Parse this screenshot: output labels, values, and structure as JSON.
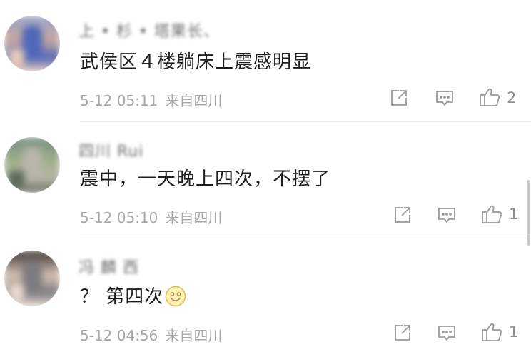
{
  "comments": [
    {
      "username": "上 • 杉 • 塔果长、",
      "text": "武侯区４楼躺床上震感明显",
      "date": "5-12 05:11",
      "source": "来自四川",
      "likes": "2",
      "avatar_colors": [
        "#9aa3c7",
        "#c8a8a0",
        "#4f67b8",
        "#e8c9b8"
      ]
    },
    {
      "username": "四川 Rui",
      "text": "震中，一天晚上四次，不摆了",
      "date": "5-12 05:10",
      "source": "来自四川",
      "likes": "1",
      "avatar_colors": [
        "#7a8d84",
        "#9fb089",
        "#b8b6a8",
        "#5c6a5a"
      ]
    },
    {
      "username": "冯 麟 西",
      "text": "？ 第四次",
      "date": "5-12 04:56",
      "source": "来自四川",
      "likes": "1",
      "avatar_colors": [
        "#3b3530",
        "#d8c3b4",
        "#7d7a80",
        "#e6d8cd"
      ]
    }
  ]
}
